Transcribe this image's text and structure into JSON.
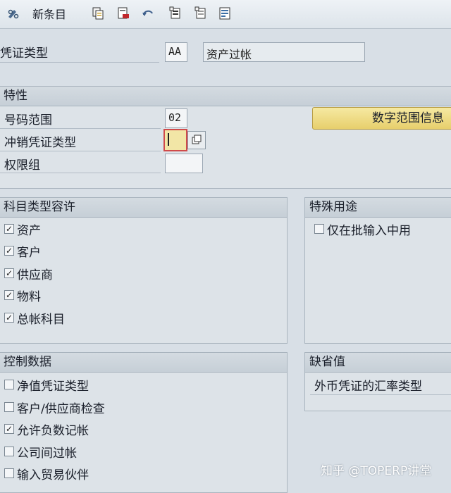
{
  "toolbar": {
    "items": [
      {
        "icon": "glasses-display-change-icon"
      },
      {
        "label": "新条目"
      },
      {
        "icon": "copy-icon"
      },
      {
        "icon": "delete-icon"
      },
      {
        "icon": "undo-icon"
      },
      {
        "icon": "select-all-icon"
      },
      {
        "icon": "deselect-icon"
      },
      {
        "icon": "detail-icon"
      }
    ]
  },
  "header": {
    "doc_type_label": "凭证类型",
    "doc_type_code": "AA",
    "doc_type_desc": "资产过帐"
  },
  "properties": {
    "title": "特性",
    "number_range_label": "号码范围",
    "number_range_value": "02",
    "number_range_button": "数字范围信息",
    "reverse_doc_type_label": "冲销凭证类型",
    "reverse_doc_type_value": "",
    "auth_group_label": "权限组",
    "auth_group_value": ""
  },
  "account_types": {
    "title": "科目类型容许",
    "items": [
      {
        "label": "资产",
        "checked": true
      },
      {
        "label": "客户",
        "checked": true
      },
      {
        "label": "供应商",
        "checked": true
      },
      {
        "label": "物料",
        "checked": true
      },
      {
        "label": "总帐科目",
        "checked": true
      }
    ]
  },
  "special_usage": {
    "title": "特殊用途",
    "items": [
      {
        "label": "仅在批输入中用",
        "checked": false
      }
    ]
  },
  "control_data": {
    "title": "控制数据",
    "items": [
      {
        "label": "净值凭证类型",
        "checked": false
      },
      {
        "label": "客户/供应商检查",
        "checked": false
      },
      {
        "label": "允许负数记帐",
        "checked": true
      },
      {
        "label": "公司间过帐",
        "checked": false
      },
      {
        "label": "输入贸易伙伴",
        "checked": false
      }
    ]
  },
  "defaults": {
    "title": "缺省值",
    "fx_rate_type_label": "外币凭证的汇率类型"
  },
  "watermark": "知乎 @TOPERP讲堂",
  "colors": {
    "accent_button": "#e7cf6c",
    "input_highlight": "#d04a4a",
    "background": "#d8dfe6"
  }
}
